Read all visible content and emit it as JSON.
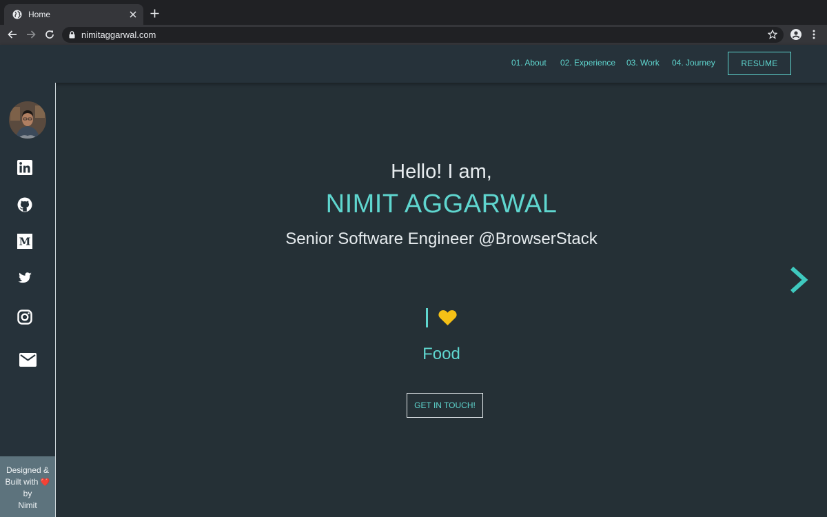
{
  "browser": {
    "tab_title": "Home",
    "url": "nimitaggarwal.com"
  },
  "nav": {
    "items": [
      {
        "label": "01. About"
      },
      {
        "label": "02. Experience"
      },
      {
        "label": "03. Work"
      },
      {
        "label": "04. Journey"
      }
    ],
    "resume_label": "RESUME"
  },
  "sidebar": {
    "socials": [
      "linkedin-icon",
      "github-icon",
      "medium-icon",
      "twitter-icon",
      "instagram-icon",
      "email-icon"
    ],
    "footer": {
      "line1": "Designed &",
      "line2": "Built with",
      "line3": "by",
      "line4": "Nimit"
    }
  },
  "hero": {
    "greeting": "Hello! I am,",
    "name": "NIMIT AGGARWAL",
    "role": "Senior Software Engineer @BrowserStack",
    "love_text": "Food",
    "cta_label": "GET IN TOUCH!"
  },
  "colors": {
    "background": "#253036",
    "accent": "#5fd6cf",
    "heart": "#f5c016",
    "footer_bg": "#5d737d"
  }
}
